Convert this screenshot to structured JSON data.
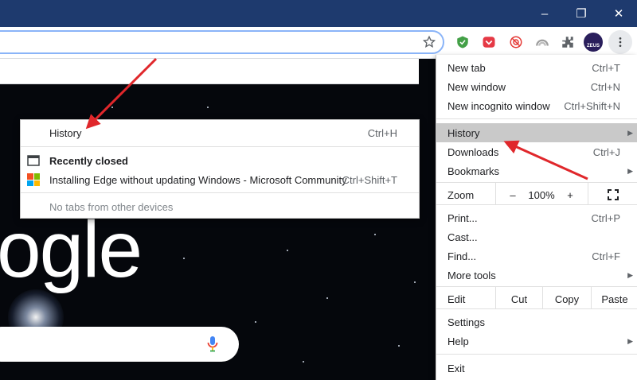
{
  "window": {
    "minimize_glyph": "–",
    "restore_glyph": "❐",
    "close_glyph": "✕"
  },
  "toolbar": {
    "icons": [
      "bookmark-star-icon",
      "adguard-shield-icon",
      "pocket-icon",
      "blocked-extension-icon",
      "rainbow-extension-icon",
      "extensions-puzzle-icon",
      "profile-avatar",
      "menu-kebab-icon"
    ],
    "avatar_text": "ZEUS"
  },
  "history_submenu": {
    "history_label": "History",
    "history_shortcut": "Ctrl+H",
    "recently_closed_label": "Recently closed",
    "closed_item_label": "Installing Edge without updating Windows - Microsoft Community",
    "closed_item_shortcut": "Ctrl+Shift+T",
    "no_tabs_label": "No tabs from other devices"
  },
  "menu": {
    "new_tab": {
      "label": "New tab",
      "shortcut": "Ctrl+T"
    },
    "new_window": {
      "label": "New window",
      "shortcut": "Ctrl+N"
    },
    "new_incognito": {
      "label": "New incognito window",
      "shortcut": "Ctrl+Shift+N"
    },
    "history": {
      "label": "History"
    },
    "downloads": {
      "label": "Downloads",
      "shortcut": "Ctrl+J"
    },
    "bookmarks": {
      "label": "Bookmarks"
    },
    "zoom": {
      "label": "Zoom",
      "minus": "–",
      "value": "100%",
      "plus": "+"
    },
    "print": {
      "label": "Print...",
      "shortcut": "Ctrl+P"
    },
    "cast": {
      "label": "Cast..."
    },
    "find": {
      "label": "Find...",
      "shortcut": "Ctrl+F"
    },
    "more_tools": {
      "label": "More tools"
    },
    "edit": {
      "label": "Edit",
      "cut": "Cut",
      "copy": "Copy",
      "paste": "Paste"
    },
    "settings": {
      "label": "Settings"
    },
    "help": {
      "label": "Help"
    },
    "exit": {
      "label": "Exit"
    }
  },
  "page": {
    "logo_fragment": "ogle"
  },
  "colors": {
    "titlebar": "#1e3a6e",
    "highlight": "#c9c9c9",
    "arrow": "#e0272b"
  }
}
